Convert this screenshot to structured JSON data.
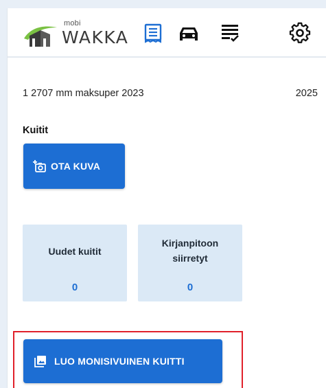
{
  "header": {
    "logo_small": "mobi",
    "logo_big": "WAKKA",
    "icons": [
      "receipt-icon",
      "car-icon",
      "checklist-icon",
      "gear-icon"
    ],
    "active_color": "#1d6ed3"
  },
  "subheader": {
    "name": "1 2707 mm maksuper 2023",
    "year": "2025"
  },
  "receipts": {
    "title": "Kuitit",
    "photo_button": "OTA KUVA",
    "cards": [
      {
        "label": "Uudet kuitit",
        "value": "0"
      },
      {
        "label": "Kirjanpitoon siirretyt",
        "value": "0"
      }
    ],
    "multipage_button": "LUO MONISIVUINEN KUITTI"
  },
  "colors": {
    "primary": "#1d6ed3",
    "card_bg": "#dbe9f6",
    "highlight": "#e0202a"
  }
}
